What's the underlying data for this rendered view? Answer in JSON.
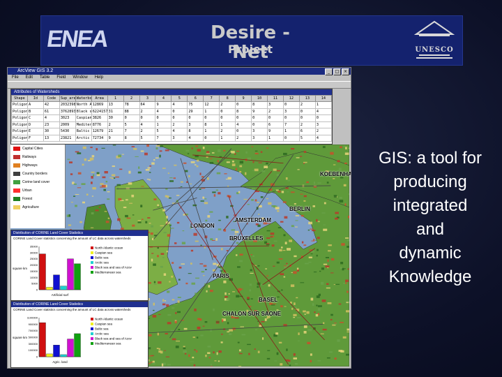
{
  "banner": {
    "left_logo": "ENEA",
    "title": "Desire - Net",
    "subtitle": "Project",
    "right_logo": "UNESCO"
  },
  "gis_window": {
    "title": "ArcView GIS 3.2",
    "menu": [
      "File",
      "Edit",
      "Table",
      "Field",
      "Window",
      "Help"
    ],
    "table_title": "Attributes of Watersheds",
    "table": {
      "headers": [
        "Shape",
        "Id",
        "Code",
        "Sup_area",
        "Waterbo",
        "Area",
        "1",
        "2",
        "3",
        "4",
        "5",
        "6",
        "7",
        "8",
        "9",
        "10",
        "11",
        "12",
        "13",
        "14"
      ],
      "rows": [
        [
          "Poligon",
          "A",
          "42",
          "20323982",
          "North Atlantic",
          "12869",
          "13",
          "78",
          "64",
          "9",
          "4",
          "75",
          "12",
          "2",
          "0",
          "8",
          "3",
          "0",
          "2",
          "1"
        ],
        [
          "Poligon",
          "B",
          "61",
          "37628930",
          "Black sea",
          "6224157",
          "31",
          "88",
          "2",
          "4",
          "0",
          "29",
          "1",
          "0",
          "8",
          "9",
          "2",
          "3",
          "0",
          "4"
        ],
        [
          "Poligon",
          "C",
          "4",
          "3023",
          "Caspian sea",
          "3826",
          "30",
          "0",
          "0",
          "0",
          "0",
          "0",
          "0",
          "0",
          "0",
          "0",
          "0",
          "0",
          "0",
          "0"
        ],
        [
          "Poligon",
          "D",
          "23",
          "2009",
          "Mediterranean",
          "8776",
          "2",
          "5",
          "4",
          "1",
          "2",
          "3",
          "8",
          "1",
          "4",
          "0",
          "6",
          "7",
          "2",
          "3"
        ],
        [
          "Poligon",
          "E",
          "30",
          "5430",
          "Baltic sea",
          "12679",
          "21",
          "7",
          "2",
          "5",
          "4",
          "8",
          "1",
          "2",
          "0",
          "3",
          "9",
          "1",
          "6",
          "2"
        ],
        [
          "Poligon",
          "F",
          "13",
          "23821",
          "Arctic sea",
          "72734",
          "9",
          "8",
          "5",
          "7",
          "3",
          "4",
          "0",
          "1",
          "2",
          "3",
          "1",
          "0",
          "5",
          "4"
        ]
      ]
    },
    "legend": [
      {
        "label": "Capital Cities",
        "color": "#e01010"
      },
      {
        "label": "Railways",
        "color": "#c03030"
      },
      {
        "label": "Highways",
        "color": "#e08020"
      },
      {
        "label": "Country borders",
        "color": "#404040"
      },
      {
        "label": "Corine land cover",
        "color": "#40a040"
      },
      {
        "label": "Urban",
        "color": "#ff3030"
      },
      {
        "label": "Forest",
        "color": "#208020"
      },
      {
        "label": "Agriculture",
        "color": "#f0d060"
      }
    ],
    "charts": [
      {
        "title": "Distribution of CORINE Land Cover Statistics",
        "subtitle": "CORINE Land Cover statistics concerning the amount of LC data across watersheds",
        "ylabel": "square km",
        "xlabel": "Artificial surf",
        "ylim": [
          0,
          35000
        ],
        "yticks": [
          "35000",
          "30000",
          "25000",
          "20000",
          "15000",
          "10000",
          "5000",
          "0"
        ],
        "series": [
          {
            "name": "North Atlantic ocean",
            "value": 29000,
            "color": "#d01010"
          },
          {
            "name": "Caspian sea",
            "value": 2000,
            "color": "#f0f020"
          },
          {
            "name": "Baltic sea",
            "value": 12000,
            "color": "#1010d0"
          },
          {
            "name": "Arctic sea",
            "value": 3000,
            "color": "#20d0d0"
          },
          {
            "name": "Black sea and sea of Azov",
            "value": 25000,
            "color": "#d010d0"
          },
          {
            "name": "Mediterranean sea",
            "value": 21000,
            "color": "#10a010"
          }
        ]
      },
      {
        "title": "Distribution of CORINE Land Cover Statistics",
        "subtitle": "CORINE Land Cover statistics concerning the amount of LC data across watersheds",
        "ylabel": "square km",
        "xlabel": "Agric. land",
        "ylim": [
          0,
          1100000
        ],
        "yticks": [
          "1100000",
          "900000",
          "700000",
          "500000",
          "300000",
          "100000",
          "0"
        ],
        "series": [
          {
            "name": "North Atlantic ocean",
            "value": 960000,
            "color": "#d01010"
          },
          {
            "name": "Caspian sea",
            "value": 80000,
            "color": "#f0f020"
          },
          {
            "name": "Baltic sea",
            "value": 330000,
            "color": "#1010d0"
          },
          {
            "name": "Arctic sea",
            "value": 60000,
            "color": "#20d0d0"
          },
          {
            "name": "Black sea and sea of Azov",
            "value": 500000,
            "color": "#d010d0"
          },
          {
            "name": "Mediterranean sea",
            "value": 650000,
            "color": "#10a010"
          }
        ]
      }
    ],
    "cities": [
      {
        "name": "KOEBENHAVN"
      },
      {
        "name": "LONDON"
      },
      {
        "name": "PARIS"
      },
      {
        "name": "BERLIN"
      },
      {
        "name": "AMSTERDAM"
      },
      {
        "name": "BRUXELLES"
      },
      {
        "name": "BASEL"
      },
      {
        "name": "CHALON SUR SAONE"
      }
    ]
  },
  "slide_text": [
    "GIS: a tool for",
    "producing",
    "integrated",
    "and",
    "dynamic",
    "Knowledge"
  ]
}
